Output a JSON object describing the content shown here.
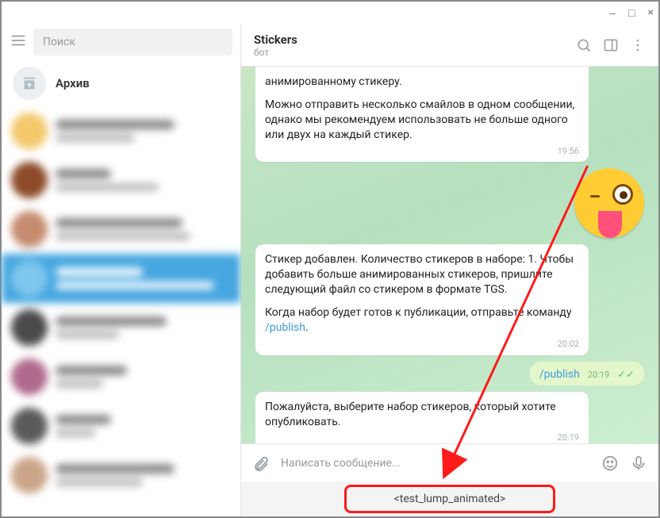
{
  "window": {
    "minimize": "‒",
    "maximize": "□",
    "close": "×"
  },
  "search": {
    "placeholder": "Поиск"
  },
  "archive": {
    "title": "Архив"
  },
  "header": {
    "title": "Stickers",
    "subtitle": "бот"
  },
  "messages": {
    "m0_partial": "анимированному стикеру.",
    "m0_body": "Можно отправить несколько смайлов в одном сообщении, однако мы рекомендуем использовать не больше одного или двух на каждый стикер.",
    "m0_time": "19:56",
    "m1_body": "Стикер добавлен. Количество стикеров в наборе: 1. Чтобы добавить больше анимированных стикеров, пришлите следующий файл со стикером в формате TGS.",
    "m1_body2_a": "Когда набор будет готов к публикации, отправьте команду ",
    "m1_link": "/publish",
    "m1_body2_b": ".",
    "m1_time": "20:02",
    "out_text": "/publish",
    "out_time": "20:19",
    "m2_body": "Пожалуйста, выберите набор стикеров, который хотите опубликовать.",
    "m2_time": "20:19"
  },
  "compose": {
    "placeholder": "Написать сообщение..."
  },
  "reply": {
    "suggestion": "<test_lump_animated>"
  }
}
